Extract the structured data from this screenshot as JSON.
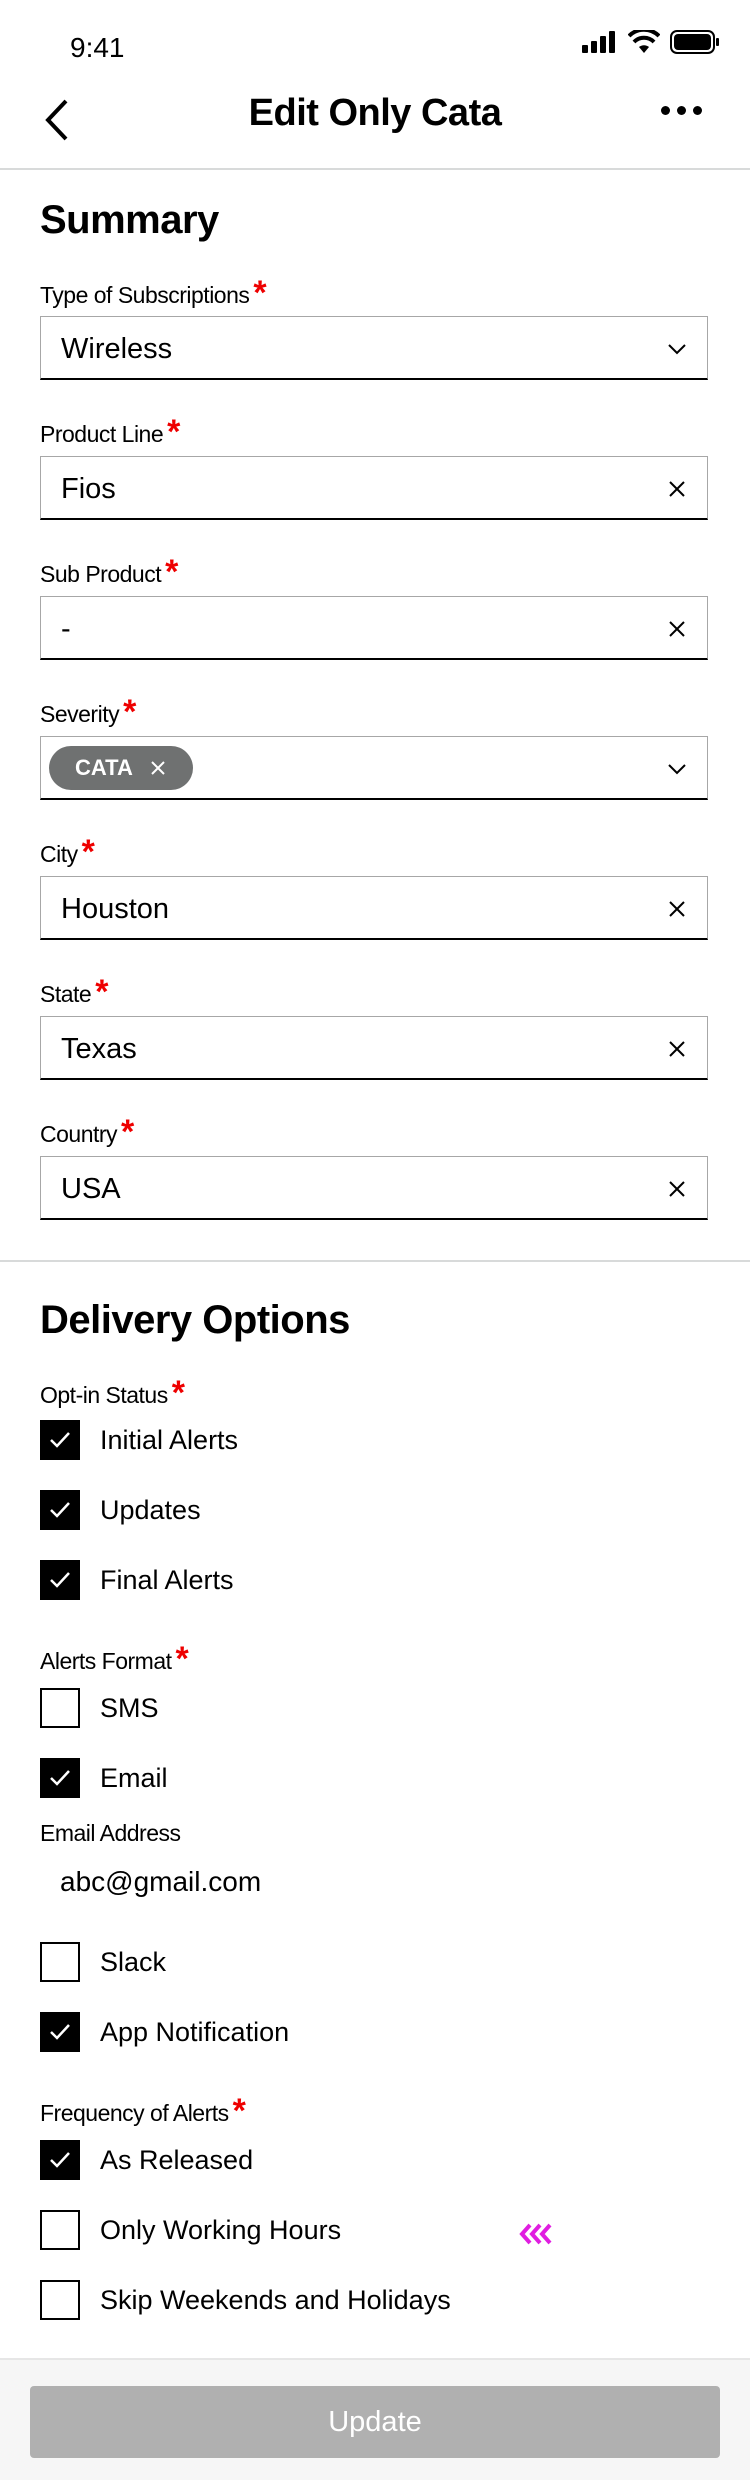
{
  "status_bar": {
    "time": "9:41",
    "icons": [
      "signal-icon",
      "wifi-icon",
      "battery-icon"
    ]
  },
  "header": {
    "title": "Edit Only Cata",
    "back_icon": "chevron-left-icon",
    "more_icon": "more-icon"
  },
  "summary": {
    "title": "Summary",
    "fields": {
      "subscription_type": {
        "label": "Type of Subscriptions",
        "value": "Wireless",
        "icon": "chevron-down-icon"
      },
      "product_line": {
        "label": "Product Line",
        "value": "Fios",
        "icon": "close-icon"
      },
      "sub_product": {
        "label": "Sub Product",
        "value": "-",
        "icon": "close-icon"
      },
      "severity": {
        "label": "Severity",
        "chip": "CATA",
        "icon": "chevron-down-icon"
      },
      "city": {
        "label": "City",
        "value": "Houston",
        "icon": "close-icon"
      },
      "state": {
        "label": "State",
        "value": "Texas",
        "icon": "close-icon"
      },
      "country": {
        "label": "Country",
        "value": "USA",
        "icon": "close-icon"
      }
    },
    "required_mark": "*"
  },
  "delivery": {
    "title": "Delivery Options",
    "opt_in": {
      "label": "Opt-in Status",
      "options": [
        {
          "label": "Initial Alerts",
          "checked": true
        },
        {
          "label": "Updates",
          "checked": true
        },
        {
          "label": "Final Alerts",
          "checked": true
        }
      ]
    },
    "alerts_format": {
      "label": "Alerts Format",
      "options": [
        {
          "label": "SMS",
          "checked": false
        },
        {
          "label": "Email",
          "checked": true
        },
        {
          "label": "Slack",
          "checked": false
        },
        {
          "label": "App Notification",
          "checked": true
        }
      ],
      "email_address_label": "Email Address",
      "email_address_value": "abc@gmail.com"
    },
    "frequency": {
      "label": "Frequency of Alerts",
      "options": [
        {
          "label": "As Released",
          "checked": true
        },
        {
          "label": "Only Working Hours",
          "checked": false
        },
        {
          "label": "Skip Weekends and Holidays",
          "checked": false
        }
      ]
    }
  },
  "footer": {
    "update_label": "Update"
  },
  "colors": {
    "required": "#ee0000",
    "chip_bg": "#6f7171",
    "button_disabled": "#b0b0b0",
    "cursor_marker": "#e01ee0"
  }
}
